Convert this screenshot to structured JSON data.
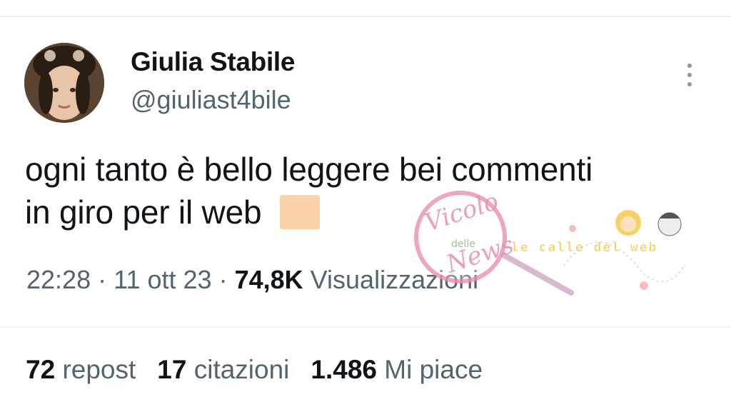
{
  "tweet": {
    "display_name": "Giulia Stabile",
    "handle": "@giuliast4bile",
    "text_line1": "ogni tanto è bello leggere bei commenti",
    "text_line2": "in giro per il web",
    "emoji": "peach-square-emoji",
    "time": "22:28",
    "date": "11 ott 23",
    "views_count": "74,8K",
    "views_label": "Visualizzazioni"
  },
  "stats": {
    "repost_count": "72",
    "repost_label": "repost",
    "quotes_count": "17",
    "quotes_label": "citazioni",
    "likes_count": "1.486",
    "likes_label": "Mi piace"
  },
  "watermark": {
    "circle_word1": "Vicolo",
    "circle_word2": "delle",
    "circle_word3": "News",
    "banner": "le calle del web"
  },
  "icons": {
    "more": "more-vertical-icon"
  },
  "colors": {
    "text_primary": "#0f1419",
    "text_secondary": "#536471",
    "divider": "#eff3f4",
    "watermark_pink": "#e98fb2",
    "banner_yellow": "#f4c94a"
  }
}
